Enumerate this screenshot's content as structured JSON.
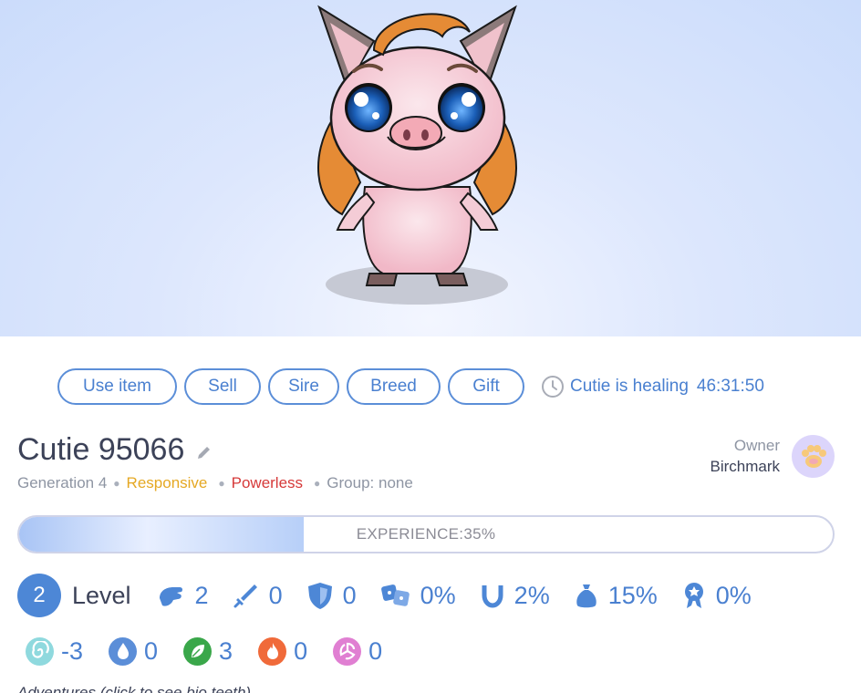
{
  "actions": {
    "use_item": "Use item",
    "sell": "Sell",
    "sire": "Sire",
    "breed": "Breed",
    "gift": "Gift"
  },
  "healing": {
    "label": "Cutie is healing",
    "timer": "46:31:50"
  },
  "cutie": {
    "name": "Cutie 95066",
    "generation": "Generation 4",
    "trait1": "Responsive",
    "trait2": "Powerless",
    "group": "Group: none"
  },
  "owner": {
    "label": "Owner",
    "name": "Birchmark"
  },
  "experience": {
    "label": "EXPERIENCE:35%",
    "fraction": 0.35
  },
  "level": {
    "value": "2",
    "label": "Level"
  },
  "stats": [
    {
      "icon": "fist-icon",
      "value": "2"
    },
    {
      "icon": "sword-icon",
      "value": "0"
    },
    {
      "icon": "shield-icon",
      "value": "0"
    },
    {
      "icon": "dice-icon",
      "value": "0%"
    },
    {
      "icon": "horseshoe-icon",
      "value": "2%"
    },
    {
      "icon": "money-bag-icon",
      "value": "15%"
    },
    {
      "icon": "badge-icon",
      "value": "0%"
    }
  ],
  "elements": [
    {
      "icon": "air-icon",
      "value": "-3",
      "color": "#8fd9de"
    },
    {
      "icon": "water-icon",
      "value": "0",
      "color": "#5b8ed8"
    },
    {
      "icon": "nature-icon",
      "value": "3",
      "color": "#3aa74a"
    },
    {
      "icon": "fire-icon",
      "value": "0",
      "color": "#f06a3a"
    },
    {
      "icon": "chaos-icon",
      "value": "0",
      "color": "#e07fd2"
    }
  ],
  "adventure_text": "Adventures (click to see bio teeth)",
  "colors": {
    "accent": "#4a80d0",
    "responsive": "#e5a823",
    "powerless": "#d63939"
  }
}
